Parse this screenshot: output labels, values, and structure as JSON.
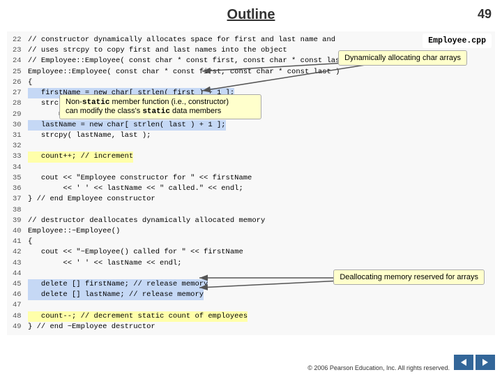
{
  "page": {
    "number": "49",
    "title": "Outline"
  },
  "callouts": {
    "employee_file": "Employee.cpp",
    "char_arrays": "Dynamically allocating char arrays",
    "static_member": "Non-static member function (i.e., constructor)\ncan modify the class's static data members",
    "dealloc": "Deallocating memory reserved for arrays"
  },
  "copyright": "© 2006 Pearson Education,\nInc.  All rights reserved.",
  "nav": {
    "prev_label": "◀",
    "next_label": "▶"
  },
  "code_lines": [
    {
      "num": "22",
      "text": "// constructor dynamically allocates space for first and last name and"
    },
    {
      "num": "23",
      "text": "// uses strcpy to copy first and last names into the object"
    },
    {
      "num": "24",
      "text": "// Employee::Employee( const char * const first, const char * const last )"
    },
    {
      "num": "25",
      "text": "Employee::Employee( const char * const first, const char * const last )"
    },
    {
      "num": "26",
      "text": "{"
    },
    {
      "num": "27",
      "text": "   firstName = new char[ strlen( first ) + 1 ];",
      "highlight": "blue"
    },
    {
      "num": "28",
      "text": "   strcpy( firstName, first );"
    },
    {
      "num": "29",
      "text": ""
    },
    {
      "num": "30",
      "text": "   lastName = new char[ strlen( last ) + 1 ];",
      "highlight": "blue"
    },
    {
      "num": "31",
      "text": "   strcpy( lastName, last );"
    },
    {
      "num": "32",
      "text": ""
    },
    {
      "num": "33",
      "text": "   count++; // increment",
      "highlight": "yellow"
    },
    {
      "num": "34",
      "text": ""
    },
    {
      "num": "35",
      "text": "   cout << \"Employee constructor for \" << firstName"
    },
    {
      "num": "36",
      "text": "        << ' ' << lastName << \" called.\" << endl;"
    },
    {
      "num": "37",
      "text": "} // end Employee constructor"
    },
    {
      "num": "38",
      "text": ""
    },
    {
      "num": "39",
      "text": "// destructor deallocates dynamically allocated memory"
    },
    {
      "num": "40",
      "text": "Employee::~Employee()"
    },
    {
      "num": "41",
      "text": "{"
    },
    {
      "num": "42",
      "text": "   cout << \"~Employee() called for \" << firstName"
    },
    {
      "num": "43",
      "text": "        << ' ' << lastName << endl;"
    },
    {
      "num": "44",
      "text": ""
    },
    {
      "num": "45",
      "text": "   delete [] firstName; // release memory",
      "highlight": "blue"
    },
    {
      "num": "46",
      "text": "   delete [] lastName; // release memory",
      "highlight": "blue"
    },
    {
      "num": "47",
      "text": ""
    },
    {
      "num": "48",
      "text": "   count--; // decrement static count of employees",
      "highlight": "yellow"
    },
    {
      "num": "49",
      "text": "} // end ~Employee destructor"
    }
  ]
}
